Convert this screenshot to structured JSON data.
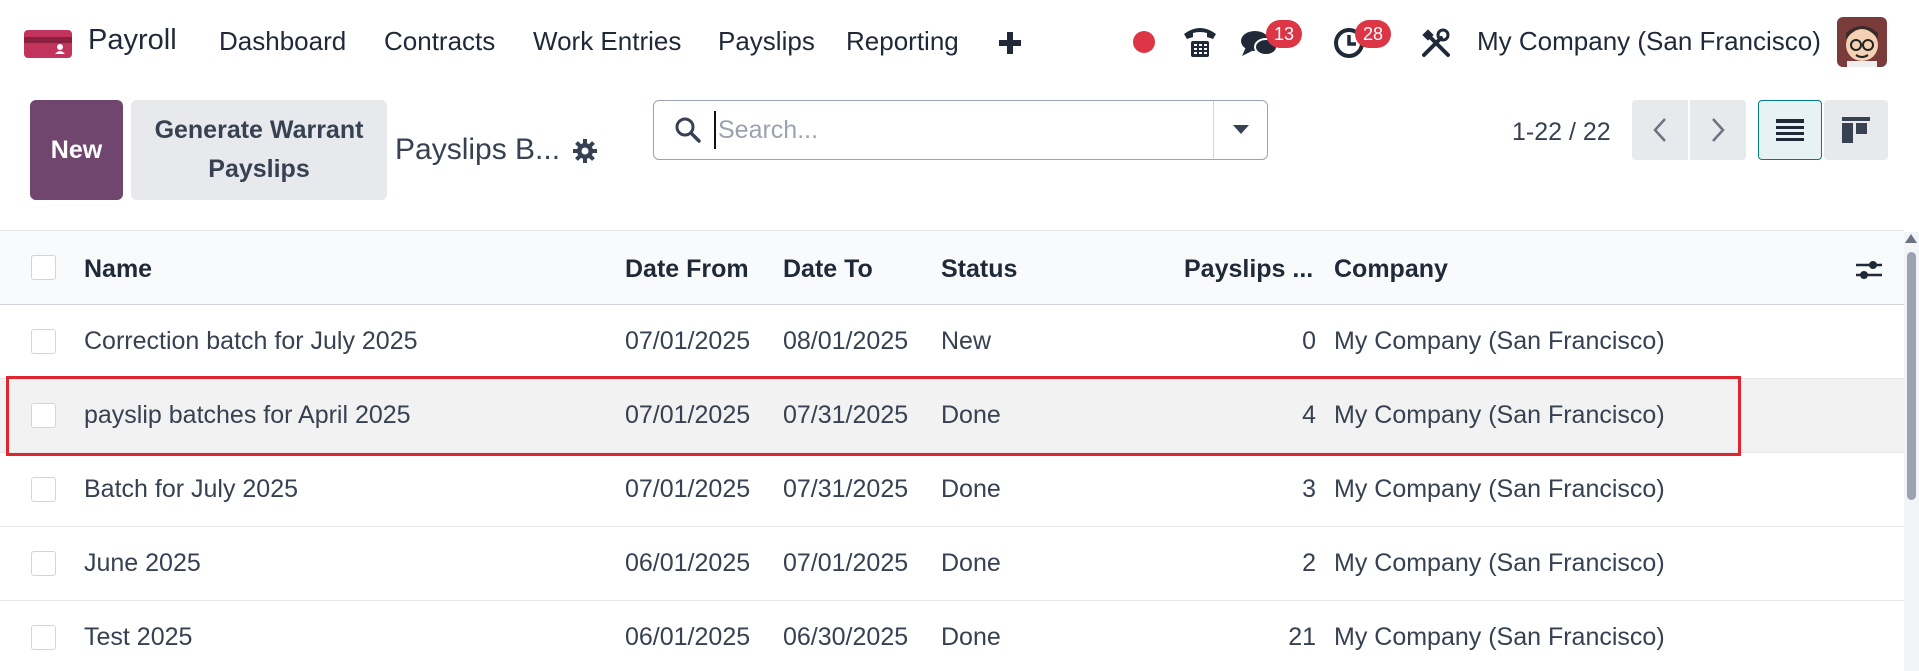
{
  "navbar": {
    "app_name": "Payroll",
    "menu": [
      "Dashboard",
      "Contracts",
      "Work Entries",
      "Payslips",
      "Reporting"
    ],
    "messages_badge": "13",
    "activities_badge": "28",
    "company": "My Company (San Francisco)",
    "icons": [
      "payroll-app-icon",
      "plus-icon",
      "recording-dot-icon",
      "phone-icon",
      "chat-icon",
      "clock-icon",
      "tools-icon",
      "user-avatar"
    ]
  },
  "control": {
    "new_label": "New",
    "generate_label": "Generate Warrant Payslips",
    "breadcrumb": "Payslips B...",
    "search_placeholder": "Search...",
    "pager": "1-22 / 22"
  },
  "list": {
    "columns": [
      "Name",
      "Date From",
      "Date To",
      "Status",
      "Payslips ...",
      "Company"
    ],
    "rows": [
      {
        "name": "Correction batch for July 2025",
        "date_from": "07/01/2025",
        "date_to": "08/01/2025",
        "status": "New",
        "payslips": "0",
        "company": "My Company (San Francisco)"
      },
      {
        "name": "payslip batches for April 2025",
        "date_from": "07/01/2025",
        "date_to": "07/31/2025",
        "status": "Done",
        "payslips": "4",
        "company": "My Company (San Francisco)"
      },
      {
        "name": "Batch for July 2025",
        "date_from": "07/01/2025",
        "date_to": "07/31/2025",
        "status": "Done",
        "payslips": "3",
        "company": "My Company (San Francisco)"
      },
      {
        "name": "June 2025",
        "date_from": "06/01/2025",
        "date_to": "07/01/2025",
        "status": "Done",
        "payslips": "2",
        "company": "My Company (San Francisco)"
      },
      {
        "name": "Test 2025",
        "date_from": "06/01/2025",
        "date_to": "06/30/2025",
        "status": "Done",
        "payslips": "21",
        "company": "My Company (San Francisco)"
      }
    ]
  },
  "colors": {
    "primary": "#71466e",
    "badge": "#dc3545",
    "highlight_frame": "#e0252e",
    "active_view": "#017e84"
  }
}
